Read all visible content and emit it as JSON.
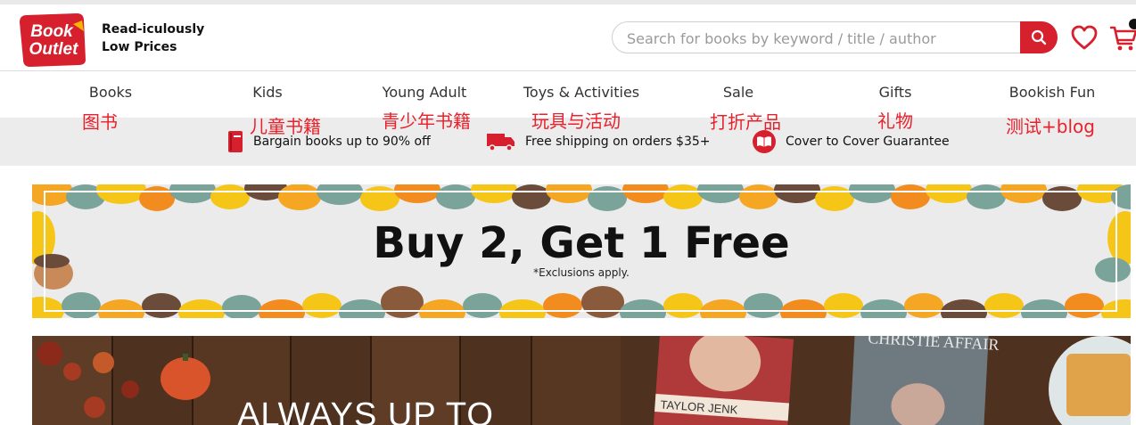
{
  "header": {
    "logo_text": [
      "Book",
      "Outlet"
    ],
    "tagline_line1": "Read-iculously",
    "tagline_line2": "Low Prices",
    "search_placeholder": "Search for books by keyword / title / author",
    "brand_color": "#d6202d"
  },
  "nav": {
    "items": [
      {
        "label": "Books",
        "note": "图书"
      },
      {
        "label": "Kids",
        "note": "儿童书籍"
      },
      {
        "label": "Young Adult",
        "note": "青少年书籍"
      },
      {
        "label": "Toys & Activities",
        "note": "玩具与活动"
      },
      {
        "label": "Sale",
        "note": "打折产品"
      },
      {
        "label": "Gifts",
        "note": "礼物"
      },
      {
        "label": "Bookish Fun",
        "note": "测试+blog"
      }
    ],
    "note_color": "#e8212c"
  },
  "promo": {
    "items": [
      {
        "text": "Bargain books up to 90% off",
        "icon": "book-icon"
      },
      {
        "text": "Free shipping on orders $35+",
        "icon": "truck-icon"
      },
      {
        "text": "Cover to Cover Guarantee",
        "icon": "open-book-badge-icon"
      }
    ]
  },
  "banner": {
    "title": "Buy 2, Get 1 Free",
    "subtitle": "*Exclusions apply."
  },
  "banner2": {
    "text": "ALWAYS UP TO",
    "book1_author": "TAYLOR JENK",
    "book2_title": "CHRISTIE AFFAIR"
  }
}
